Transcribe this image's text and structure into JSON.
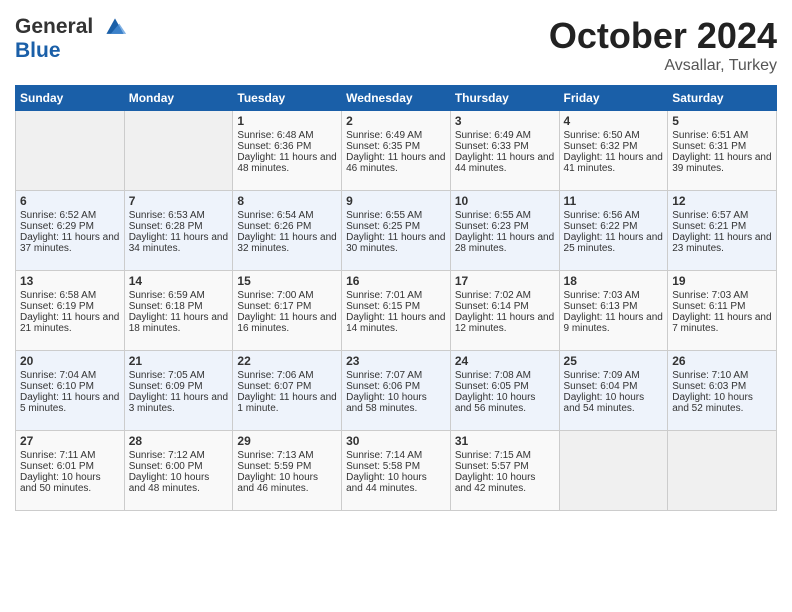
{
  "logo": {
    "line1": "General",
    "line2": "Blue"
  },
  "title": "October 2024",
  "location": "Avsallar, Turkey",
  "days_of_week": [
    "Sunday",
    "Monday",
    "Tuesday",
    "Wednesday",
    "Thursday",
    "Friday",
    "Saturday"
  ],
  "weeks": [
    [
      {
        "day": "",
        "empty": true
      },
      {
        "day": "",
        "empty": true
      },
      {
        "day": "1",
        "sunrise": "Sunrise: 6:48 AM",
        "sunset": "Sunset: 6:36 PM",
        "daylight": "Daylight: 11 hours and 48 minutes."
      },
      {
        "day": "2",
        "sunrise": "Sunrise: 6:49 AM",
        "sunset": "Sunset: 6:35 PM",
        "daylight": "Daylight: 11 hours and 46 minutes."
      },
      {
        "day": "3",
        "sunrise": "Sunrise: 6:49 AM",
        "sunset": "Sunset: 6:33 PM",
        "daylight": "Daylight: 11 hours and 44 minutes."
      },
      {
        "day": "4",
        "sunrise": "Sunrise: 6:50 AM",
        "sunset": "Sunset: 6:32 PM",
        "daylight": "Daylight: 11 hours and 41 minutes."
      },
      {
        "day": "5",
        "sunrise": "Sunrise: 6:51 AM",
        "sunset": "Sunset: 6:31 PM",
        "daylight": "Daylight: 11 hours and 39 minutes."
      }
    ],
    [
      {
        "day": "6",
        "sunrise": "Sunrise: 6:52 AM",
        "sunset": "Sunset: 6:29 PM",
        "daylight": "Daylight: 11 hours and 37 minutes."
      },
      {
        "day": "7",
        "sunrise": "Sunrise: 6:53 AM",
        "sunset": "Sunset: 6:28 PM",
        "daylight": "Daylight: 11 hours and 34 minutes."
      },
      {
        "day": "8",
        "sunrise": "Sunrise: 6:54 AM",
        "sunset": "Sunset: 6:26 PM",
        "daylight": "Daylight: 11 hours and 32 minutes."
      },
      {
        "day": "9",
        "sunrise": "Sunrise: 6:55 AM",
        "sunset": "Sunset: 6:25 PM",
        "daylight": "Daylight: 11 hours and 30 minutes."
      },
      {
        "day": "10",
        "sunrise": "Sunrise: 6:55 AM",
        "sunset": "Sunset: 6:23 PM",
        "daylight": "Daylight: 11 hours and 28 minutes."
      },
      {
        "day": "11",
        "sunrise": "Sunrise: 6:56 AM",
        "sunset": "Sunset: 6:22 PM",
        "daylight": "Daylight: 11 hours and 25 minutes."
      },
      {
        "day": "12",
        "sunrise": "Sunrise: 6:57 AM",
        "sunset": "Sunset: 6:21 PM",
        "daylight": "Daylight: 11 hours and 23 minutes."
      }
    ],
    [
      {
        "day": "13",
        "sunrise": "Sunrise: 6:58 AM",
        "sunset": "Sunset: 6:19 PM",
        "daylight": "Daylight: 11 hours and 21 minutes."
      },
      {
        "day": "14",
        "sunrise": "Sunrise: 6:59 AM",
        "sunset": "Sunset: 6:18 PM",
        "daylight": "Daylight: 11 hours and 18 minutes."
      },
      {
        "day": "15",
        "sunrise": "Sunrise: 7:00 AM",
        "sunset": "Sunset: 6:17 PM",
        "daylight": "Daylight: 11 hours and 16 minutes."
      },
      {
        "day": "16",
        "sunrise": "Sunrise: 7:01 AM",
        "sunset": "Sunset: 6:15 PM",
        "daylight": "Daylight: 11 hours and 14 minutes."
      },
      {
        "day": "17",
        "sunrise": "Sunrise: 7:02 AM",
        "sunset": "Sunset: 6:14 PM",
        "daylight": "Daylight: 11 hours and 12 minutes."
      },
      {
        "day": "18",
        "sunrise": "Sunrise: 7:03 AM",
        "sunset": "Sunset: 6:13 PM",
        "daylight": "Daylight: 11 hours and 9 minutes."
      },
      {
        "day": "19",
        "sunrise": "Sunrise: 7:03 AM",
        "sunset": "Sunset: 6:11 PM",
        "daylight": "Daylight: 11 hours and 7 minutes."
      }
    ],
    [
      {
        "day": "20",
        "sunrise": "Sunrise: 7:04 AM",
        "sunset": "Sunset: 6:10 PM",
        "daylight": "Daylight: 11 hours and 5 minutes."
      },
      {
        "day": "21",
        "sunrise": "Sunrise: 7:05 AM",
        "sunset": "Sunset: 6:09 PM",
        "daylight": "Daylight: 11 hours and 3 minutes."
      },
      {
        "day": "22",
        "sunrise": "Sunrise: 7:06 AM",
        "sunset": "Sunset: 6:07 PM",
        "daylight": "Daylight: 11 hours and 1 minute."
      },
      {
        "day": "23",
        "sunrise": "Sunrise: 7:07 AM",
        "sunset": "Sunset: 6:06 PM",
        "daylight": "Daylight: 10 hours and 58 minutes."
      },
      {
        "day": "24",
        "sunrise": "Sunrise: 7:08 AM",
        "sunset": "Sunset: 6:05 PM",
        "daylight": "Daylight: 10 hours and 56 minutes."
      },
      {
        "day": "25",
        "sunrise": "Sunrise: 7:09 AM",
        "sunset": "Sunset: 6:04 PM",
        "daylight": "Daylight: 10 hours and 54 minutes."
      },
      {
        "day": "26",
        "sunrise": "Sunrise: 7:10 AM",
        "sunset": "Sunset: 6:03 PM",
        "daylight": "Daylight: 10 hours and 52 minutes."
      }
    ],
    [
      {
        "day": "27",
        "sunrise": "Sunrise: 7:11 AM",
        "sunset": "Sunset: 6:01 PM",
        "daylight": "Daylight: 10 hours and 50 minutes."
      },
      {
        "day": "28",
        "sunrise": "Sunrise: 7:12 AM",
        "sunset": "Sunset: 6:00 PM",
        "daylight": "Daylight: 10 hours and 48 minutes."
      },
      {
        "day": "29",
        "sunrise": "Sunrise: 7:13 AM",
        "sunset": "Sunset: 5:59 PM",
        "daylight": "Daylight: 10 hours and 46 minutes."
      },
      {
        "day": "30",
        "sunrise": "Sunrise: 7:14 AM",
        "sunset": "Sunset: 5:58 PM",
        "daylight": "Daylight: 10 hours and 44 minutes."
      },
      {
        "day": "31",
        "sunrise": "Sunrise: 7:15 AM",
        "sunset": "Sunset: 5:57 PM",
        "daylight": "Daylight: 10 hours and 42 minutes."
      },
      {
        "day": "",
        "empty": true
      },
      {
        "day": "",
        "empty": true
      }
    ]
  ]
}
